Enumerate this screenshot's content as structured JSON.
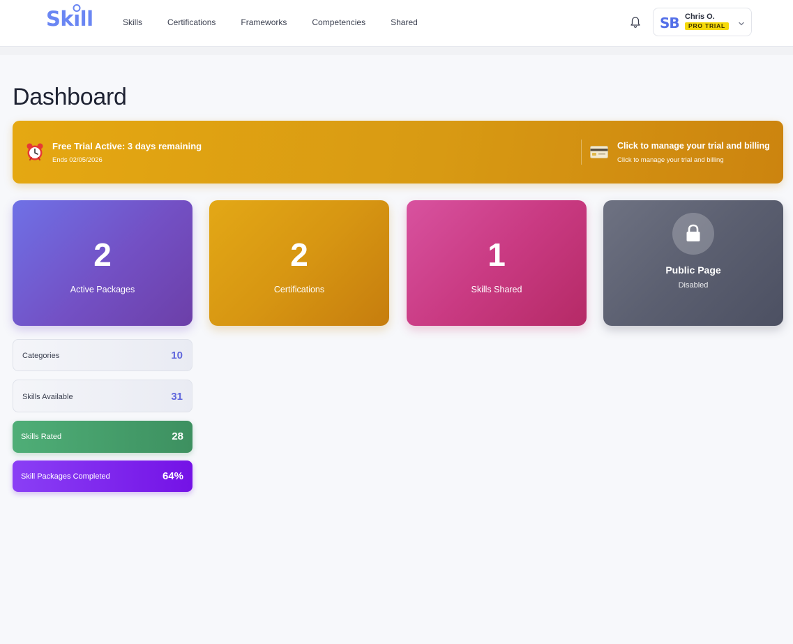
{
  "header": {
    "logo_text": "Skill",
    "nav": [
      "Skills",
      "Certifications",
      "Frameworks",
      "Competencies",
      "Shared"
    ],
    "notifications_icon": "bell-icon",
    "user": {
      "avatar_text": "SB",
      "name": "Chris O.",
      "plan_badge": "PRO TRIAL",
      "menu_icon": "chevron-down-icon"
    }
  },
  "page": {
    "title": "Dashboard"
  },
  "trial_banner": {
    "icon": "alarm-clock-icon",
    "title": "Free Trial Active: 3 days remaining",
    "subtitle": "Ends 02/05/2026",
    "manage_icon": "credit-card-icon",
    "manage_title": "Click to manage your trial and billing",
    "manage_subtitle": "Click to manage your trial and billing"
  },
  "stats": [
    {
      "value": "2",
      "label": "Active Packages"
    },
    {
      "value": "2",
      "label": "Certifications"
    },
    {
      "value": "1",
      "label": "Skills Shared"
    }
  ],
  "public_page": {
    "icon": "lock-icon",
    "title": "Public Page",
    "status": "Disabled"
  },
  "metrics": [
    {
      "label": "Categories",
      "value": "10"
    },
    {
      "label": "Skills Available",
      "value": "31"
    },
    {
      "label": "Skills Rated",
      "value": "28"
    },
    {
      "label": "Skill Packages Completed",
      "value": "64%"
    }
  ],
  "colors": {
    "brand": "#6a86f3",
    "trial_banner": "#dc9d13",
    "packages_card": "#7350c4",
    "certifications_card": "#d79612",
    "skills_shared_card": "#c93a82",
    "public_page_card": "#5b5f70",
    "skills_rated": "#4a9f6c",
    "packages_completed": "#7e26ee",
    "pro_badge": "#f5d90a"
  }
}
